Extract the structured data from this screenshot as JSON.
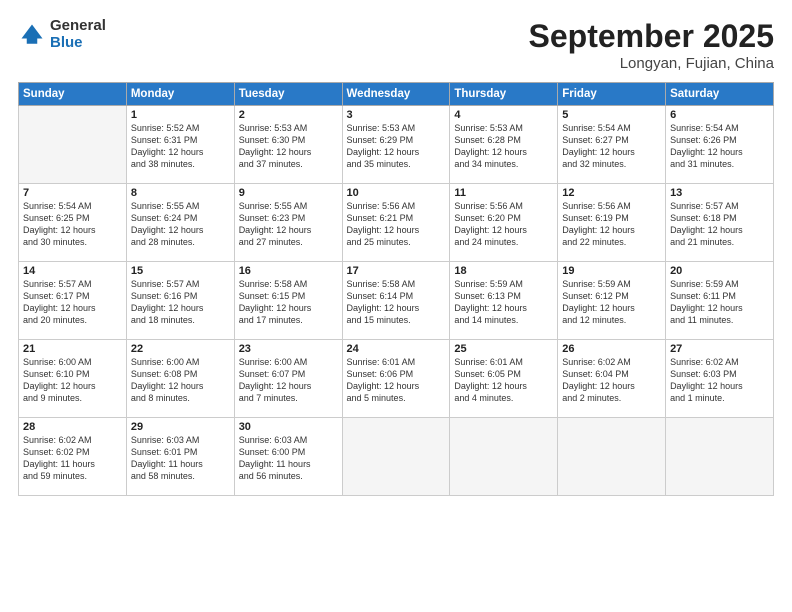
{
  "header": {
    "logo_general": "General",
    "logo_blue": "Blue",
    "month": "September 2025",
    "location": "Longyan, Fujian, China"
  },
  "days_of_week": [
    "Sunday",
    "Monday",
    "Tuesday",
    "Wednesday",
    "Thursday",
    "Friday",
    "Saturday"
  ],
  "weeks": [
    [
      {
        "day": "",
        "detail": ""
      },
      {
        "day": "1",
        "detail": "Sunrise: 5:52 AM\nSunset: 6:31 PM\nDaylight: 12 hours\nand 38 minutes."
      },
      {
        "day": "2",
        "detail": "Sunrise: 5:53 AM\nSunset: 6:30 PM\nDaylight: 12 hours\nand 37 minutes."
      },
      {
        "day": "3",
        "detail": "Sunrise: 5:53 AM\nSunset: 6:29 PM\nDaylight: 12 hours\nand 35 minutes."
      },
      {
        "day": "4",
        "detail": "Sunrise: 5:53 AM\nSunset: 6:28 PM\nDaylight: 12 hours\nand 34 minutes."
      },
      {
        "day": "5",
        "detail": "Sunrise: 5:54 AM\nSunset: 6:27 PM\nDaylight: 12 hours\nand 32 minutes."
      },
      {
        "day": "6",
        "detail": "Sunrise: 5:54 AM\nSunset: 6:26 PM\nDaylight: 12 hours\nand 31 minutes."
      }
    ],
    [
      {
        "day": "7",
        "detail": "Sunrise: 5:54 AM\nSunset: 6:25 PM\nDaylight: 12 hours\nand 30 minutes."
      },
      {
        "day": "8",
        "detail": "Sunrise: 5:55 AM\nSunset: 6:24 PM\nDaylight: 12 hours\nand 28 minutes."
      },
      {
        "day": "9",
        "detail": "Sunrise: 5:55 AM\nSunset: 6:23 PM\nDaylight: 12 hours\nand 27 minutes."
      },
      {
        "day": "10",
        "detail": "Sunrise: 5:56 AM\nSunset: 6:21 PM\nDaylight: 12 hours\nand 25 minutes."
      },
      {
        "day": "11",
        "detail": "Sunrise: 5:56 AM\nSunset: 6:20 PM\nDaylight: 12 hours\nand 24 minutes."
      },
      {
        "day": "12",
        "detail": "Sunrise: 5:56 AM\nSunset: 6:19 PM\nDaylight: 12 hours\nand 22 minutes."
      },
      {
        "day": "13",
        "detail": "Sunrise: 5:57 AM\nSunset: 6:18 PM\nDaylight: 12 hours\nand 21 minutes."
      }
    ],
    [
      {
        "day": "14",
        "detail": "Sunrise: 5:57 AM\nSunset: 6:17 PM\nDaylight: 12 hours\nand 20 minutes."
      },
      {
        "day": "15",
        "detail": "Sunrise: 5:57 AM\nSunset: 6:16 PM\nDaylight: 12 hours\nand 18 minutes."
      },
      {
        "day": "16",
        "detail": "Sunrise: 5:58 AM\nSunset: 6:15 PM\nDaylight: 12 hours\nand 17 minutes."
      },
      {
        "day": "17",
        "detail": "Sunrise: 5:58 AM\nSunset: 6:14 PM\nDaylight: 12 hours\nand 15 minutes."
      },
      {
        "day": "18",
        "detail": "Sunrise: 5:59 AM\nSunset: 6:13 PM\nDaylight: 12 hours\nand 14 minutes."
      },
      {
        "day": "19",
        "detail": "Sunrise: 5:59 AM\nSunset: 6:12 PM\nDaylight: 12 hours\nand 12 minutes."
      },
      {
        "day": "20",
        "detail": "Sunrise: 5:59 AM\nSunset: 6:11 PM\nDaylight: 12 hours\nand 11 minutes."
      }
    ],
    [
      {
        "day": "21",
        "detail": "Sunrise: 6:00 AM\nSunset: 6:10 PM\nDaylight: 12 hours\nand 9 minutes."
      },
      {
        "day": "22",
        "detail": "Sunrise: 6:00 AM\nSunset: 6:08 PM\nDaylight: 12 hours\nand 8 minutes."
      },
      {
        "day": "23",
        "detail": "Sunrise: 6:00 AM\nSunset: 6:07 PM\nDaylight: 12 hours\nand 7 minutes."
      },
      {
        "day": "24",
        "detail": "Sunrise: 6:01 AM\nSunset: 6:06 PM\nDaylight: 12 hours\nand 5 minutes."
      },
      {
        "day": "25",
        "detail": "Sunrise: 6:01 AM\nSunset: 6:05 PM\nDaylight: 12 hours\nand 4 minutes."
      },
      {
        "day": "26",
        "detail": "Sunrise: 6:02 AM\nSunset: 6:04 PM\nDaylight: 12 hours\nand 2 minutes."
      },
      {
        "day": "27",
        "detail": "Sunrise: 6:02 AM\nSunset: 6:03 PM\nDaylight: 12 hours\nand 1 minute."
      }
    ],
    [
      {
        "day": "28",
        "detail": "Sunrise: 6:02 AM\nSunset: 6:02 PM\nDaylight: 11 hours\nand 59 minutes."
      },
      {
        "day": "29",
        "detail": "Sunrise: 6:03 AM\nSunset: 6:01 PM\nDaylight: 11 hours\nand 58 minutes."
      },
      {
        "day": "30",
        "detail": "Sunrise: 6:03 AM\nSunset: 6:00 PM\nDaylight: 11 hours\nand 56 minutes."
      },
      {
        "day": "",
        "detail": ""
      },
      {
        "day": "",
        "detail": ""
      },
      {
        "day": "",
        "detail": ""
      },
      {
        "day": "",
        "detail": ""
      }
    ]
  ]
}
